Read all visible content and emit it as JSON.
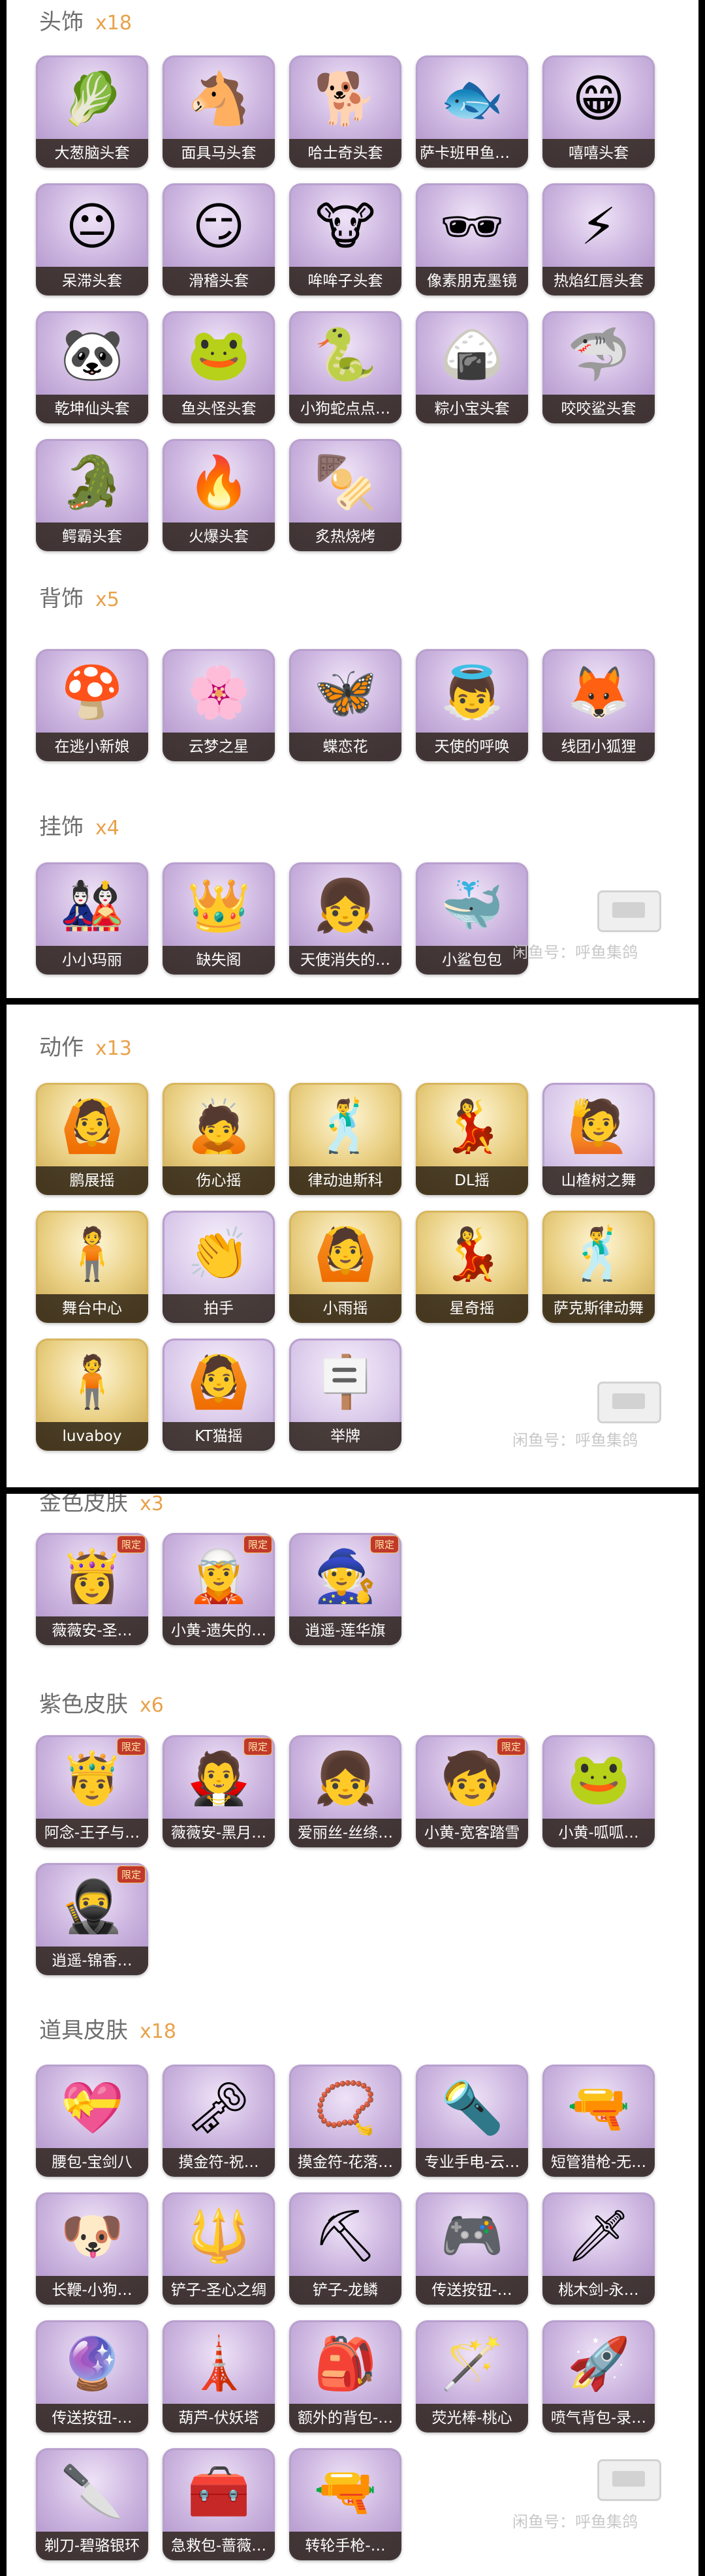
{
  "watermark": {
    "text": "闲鱼号：呼鱼集鸽"
  },
  "panel1": {
    "sections": [
      {
        "title": "头饰",
        "count": "x18",
        "items": [
          {
            "label": "大葱脑头套",
            "icon": "scallion",
            "glyph": "🥬"
          },
          {
            "label": "面具马头套",
            "icon": "horse-mask",
            "glyph": "🐴"
          },
          {
            "label": "哈士奇头套",
            "icon": "husky",
            "glyph": "🐕"
          },
          {
            "label": "萨卡班甲鱼头套",
            "icon": "fish",
            "glyph": "🐟"
          },
          {
            "label": "嘻嘻头套",
            "icon": "grin-emoji",
            "glyph": "😁"
          },
          {
            "label": "呆滞头套",
            "icon": "dull-emoji",
            "glyph": "😐"
          },
          {
            "label": "滑稽头套",
            "icon": "funny-emoji",
            "glyph": "😏"
          },
          {
            "label": "哞哞子头套",
            "icon": "cow",
            "glyph": "🐮"
          },
          {
            "label": "像素朋克墨镜",
            "icon": "pixel-sunglasses",
            "glyph": "🕶"
          },
          {
            "label": "热焰红唇头套",
            "icon": "pikachu",
            "glyph": "⚡"
          },
          {
            "label": "乾坤仙头套",
            "icon": "panda",
            "glyph": "🐼"
          },
          {
            "label": "鱼头怪头套",
            "icon": "fish-monster",
            "glyph": "🐸"
          },
          {
            "label": "小狗蛇点点…",
            "icon": "snake",
            "glyph": "🐍"
          },
          {
            "label": "粽小宝头套",
            "icon": "zongzi",
            "glyph": "🍙"
          },
          {
            "label": "咬咬鲨头套",
            "icon": "shark",
            "glyph": "🦈"
          },
          {
            "label": "鳄霸头套",
            "icon": "crocodile",
            "glyph": "🐊"
          },
          {
            "label": "火爆头套",
            "icon": "fire",
            "glyph": "🔥"
          },
          {
            "label": "炙热烧烤",
            "icon": "bbq",
            "glyph": "🍢"
          }
        ]
      },
      {
        "title": "背饰",
        "count": "x5",
        "items": [
          {
            "label": "在逃小新娘",
            "icon": "mushroom",
            "glyph": "🍄"
          },
          {
            "label": "云梦之星",
            "icon": "cloud-star",
            "glyph": "🌸"
          },
          {
            "label": "蝶恋花",
            "icon": "butterfly",
            "glyph": "🦋"
          },
          {
            "label": "天使的呼唤",
            "icon": "angel",
            "glyph": "👼"
          },
          {
            "label": "线团小狐狸",
            "icon": "fox",
            "glyph": "🦊"
          }
        ]
      },
      {
        "title": "挂饰",
        "count": "x4",
        "items": [
          {
            "label": "小小玛丽",
            "icon": "doll",
            "glyph": "🎎"
          },
          {
            "label": "缺失阁",
            "icon": "crown-doll",
            "glyph": "👑"
          },
          {
            "label": "天使消失的…",
            "icon": "angel-doll",
            "glyph": "👧"
          },
          {
            "label": "小鲨包包",
            "icon": "shark-pouch",
            "glyph": "🐳"
          }
        ]
      }
    ]
  },
  "panel2": {
    "sections": [
      {
        "title": "动作",
        "count": "x13",
        "items": [
          {
            "label": "鹏展摇",
            "icon": "pose",
            "glyph": "🙆",
            "style": "gold"
          },
          {
            "label": "伤心摇",
            "icon": "pose",
            "glyph": "🙇",
            "style": "gold"
          },
          {
            "label": "律动迪斯科",
            "icon": "pose",
            "glyph": "🕺",
            "style": "gold"
          },
          {
            "label": "DL摇",
            "icon": "pose",
            "glyph": "💃",
            "style": "gold"
          },
          {
            "label": "山楂树之舞",
            "icon": "pose",
            "glyph": "🙋",
            "style": "lilac"
          },
          {
            "label": "舞台中心",
            "icon": "pose",
            "glyph": "🧍",
            "style": "gold"
          },
          {
            "label": "拍手",
            "icon": "pose",
            "glyph": "👏",
            "style": "lilac"
          },
          {
            "label": "小雨摇",
            "icon": "pose",
            "glyph": "🙆",
            "style": "gold"
          },
          {
            "label": "星奇摇",
            "icon": "pose",
            "glyph": "💃",
            "style": "gold"
          },
          {
            "label": "萨克斯律动舞",
            "icon": "pose",
            "glyph": "🕺",
            "style": "gold"
          },
          {
            "label": "luvaboy",
            "icon": "pose",
            "glyph": "🧍",
            "style": "gold"
          },
          {
            "label": "KT猫摇",
            "icon": "pose",
            "glyph": "🙆",
            "style": "lilac"
          },
          {
            "label": "举牌",
            "icon": "sign",
            "glyph": "🪧",
            "style": "lilac"
          }
        ]
      }
    ]
  },
  "panel3": {
    "cut_title": "金色皮肤",
    "cut_count": "x3",
    "cut_items": [
      {
        "label": "薇薇安-圣…",
        "icon": "character",
        "glyph": "👸",
        "corner": "限定"
      },
      {
        "label": "小黄-遗失的…",
        "icon": "character",
        "glyph": "🧝",
        "corner": "限定"
      },
      {
        "label": "逍遥-莲华旗",
        "icon": "character",
        "glyph": "🧙",
        "corner": "限定"
      }
    ],
    "sections": [
      {
        "title": "紫色皮肤",
        "count": "x6",
        "items": [
          {
            "label": "阿念-王子与…",
            "icon": "character",
            "glyph": "🤴",
            "corner": "限定"
          },
          {
            "label": "薇薇安-黑月…",
            "icon": "character",
            "glyph": "🧛",
            "corner": "限定"
          },
          {
            "label": "爱丽丝-丝绦…",
            "icon": "character",
            "glyph": "👧"
          },
          {
            "label": "小黄-宽客踏雪",
            "icon": "character",
            "glyph": "🧒",
            "corner": "限定"
          },
          {
            "label": "小黄-呱呱…",
            "icon": "character",
            "glyph": "🐸"
          },
          {
            "label": "逍遥-锦香…",
            "icon": "character",
            "glyph": "🥷",
            "corner": "限定"
          }
        ]
      },
      {
        "title": "道具皮肤",
        "count": "x18",
        "items": [
          {
            "label": "腰包-宝剑八",
            "icon": "pouch",
            "glyph": "💝"
          },
          {
            "label": "摸金符-祝…",
            "icon": "talisman",
            "glyph": "🗝"
          },
          {
            "label": "摸金符-花落…",
            "icon": "talisman",
            "glyph": "📿"
          },
          {
            "label": "专业手电-云…",
            "icon": "flashlight",
            "glyph": "🔦"
          },
          {
            "label": "短管猎枪-无…",
            "icon": "shotgun",
            "glyph": "🔫"
          },
          {
            "label": "长鞭-小狗…",
            "icon": "whip",
            "glyph": "🐶"
          },
          {
            "label": "铲子-圣心之绸",
            "icon": "shovel",
            "glyph": "🔱"
          },
          {
            "label": "铲子-龙鳞",
            "icon": "shovel",
            "glyph": "⛏"
          },
          {
            "label": "传送按钮-…",
            "icon": "button",
            "glyph": "🎮"
          },
          {
            "label": "桃木剑-永…",
            "icon": "sword",
            "glyph": "🗡"
          },
          {
            "label": "传送按钮-…",
            "icon": "button",
            "glyph": "🔮"
          },
          {
            "label": "葫芦-伏妖塔",
            "icon": "pagoda",
            "glyph": "🗼"
          },
          {
            "label": "额外的背包-…",
            "icon": "backpack",
            "glyph": "🎒"
          },
          {
            "label": "荧光棒-桃心",
            "icon": "glowstick",
            "glyph": "🪄"
          },
          {
            "label": "喷气背包-录…",
            "icon": "jetpack",
            "glyph": "🚀"
          },
          {
            "label": "剃刀-碧骆银环",
            "icon": "razor",
            "glyph": "🔪"
          },
          {
            "label": "急救包-蔷薇…",
            "icon": "medkit",
            "glyph": "🧰"
          },
          {
            "label": "转轮手枪-…",
            "icon": "revolver",
            "glyph": "🔫"
          }
        ]
      }
    ]
  }
}
